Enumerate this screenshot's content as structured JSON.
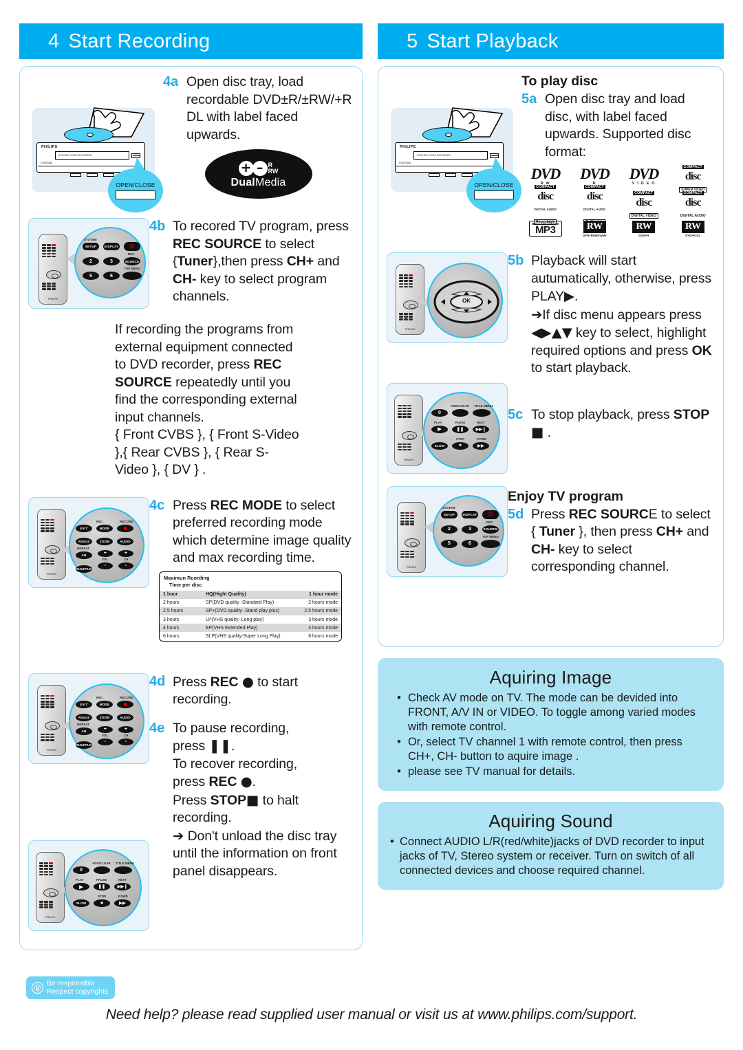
{
  "sections": {
    "recording": {
      "number": "4",
      "title": "Start Recording"
    },
    "playback": {
      "number": "5",
      "title": "Start Playback"
    }
  },
  "recording_steps": {
    "a": {
      "num": "4a",
      "text": "Open disc tray, load recordable DVD±R/±RW/+R DL with label faced upwards."
    },
    "b": {
      "num": "4b",
      "line1": "To recored TV program,",
      "press1": "press ",
      "bold1": "REC SOURCE",
      "after1": " to select {",
      "bold2": "Tuner",
      "after2": "},then press ",
      "bold3": "CH+",
      "and": " and ",
      "bold4": "CH-",
      "after3": " key to select program channels.",
      "para2_a": "If recording the programs from external equipment connected to DVD recorder, press ",
      "para2_bold": "REC SOURCE",
      "para2_b": " repeatedly until you find the corresponding external input channels.",
      "para3": "{ Front CVBS }, { Front S-Video },{ Rear CVBS }, { Rear S-Video }, { DV } ."
    },
    "c": {
      "num": "4c",
      "pre": "Press ",
      "bold": "REC MODE",
      "post": " to select preferred recording mode which determine image quality and max recording time."
    },
    "d": {
      "num": "4d",
      "pre": "Press ",
      "bold": "REC",
      "glyph": "●",
      "post": " to start recording."
    },
    "e": {
      "num": "4e",
      "l1": "To pause recording,",
      "l2_pre": "press ",
      "l2_glyph": "❚❚",
      "l2_post": ".",
      "l3": "To recover recording,",
      "l4_pre": "press ",
      "l4_bold": "REC",
      "l4_glyph": "●",
      "l4_post": ".",
      "l5_pre": "Press ",
      "l5_bold": "STOP",
      "l5_glyph": "■",
      "l5_post": " to halt recording.",
      "l6_arrow": "➔",
      "l6": " Don't unload the disc tray until the information on front panel disappears."
    }
  },
  "rec_table": {
    "title_line1": "Maximun Rcording",
    "title_line2": "Time per disc",
    "rows": [
      {
        "time": "1 hour",
        "mode": "HQ(Hight Quality)",
        "max": "1 hour mode"
      },
      {
        "time": "2 hours",
        "mode": "SP(DVD quality -Standard Play)",
        "max": "2 hours mode"
      },
      {
        "time": "2.5 hours",
        "mode": "SP+(DVD quality- Stand play plus)",
        "max": "2.5 hours mode"
      },
      {
        "time": "3 hours",
        "mode": "LP(VHS quality- Long play)",
        "max": "3 hours mode"
      },
      {
        "time": "4 hours",
        "mode": "EP(VHS Extended Play)",
        "max": "4 hours mode"
      },
      {
        "time": "6 hours",
        "mode": "SLP(VHS quality-Super Long Play)",
        "max": "6 hours mode"
      }
    ]
  },
  "playback_steps": {
    "heading_play": "To play disc",
    "a": {
      "num": "5a",
      "text": "Open disc tray and load disc,  with label faced upwards.",
      "supported": "Supported disc format:"
    },
    "b": {
      "num": "5b",
      "l1": "Playback will start autumatically,  otherwise, press  PLAY",
      "l1_glyph": "▶",
      "l1_end": ".",
      "arrow": "➔",
      "l2": "If disc menu appears press ",
      "l2_glyphs": "◀▶▲▼",
      "l3_pre": " key to select, highlight  required options and press ",
      "l3_bold": "OK",
      "l3_post": " to start playback."
    },
    "c": {
      "num": "5c",
      "pre": "To stop playback, press ",
      "bold": "STOP",
      "glyph": "■",
      "post": " ."
    },
    "heading_enjoy": "Enjoy  TV program",
    "d": {
      "num": "5d",
      "pre": "Press ",
      "bold1": "REC SOURC",
      "mid1": "E to select { ",
      "bold2": "Tuner",
      "mid2": " }, then press ",
      "bold3": "CH+",
      "mid3": " and ",
      "bold4": "CH-",
      "post": "  key to select corresponding channel."
    }
  },
  "aquiring_image": {
    "title": "Aquiring Image",
    "bullets": [
      "Check AV mode on TV.  The mode can be devided into FRONT, A/V IN or VIDEO. To toggle among varied modes with remote control.",
      "Or, select TV channel 1 with remote control, then press CH+, CH- button to aquire image .",
      "please see TV manual for details."
    ],
    "bullet_glyph": "•"
  },
  "aquiring_sound": {
    "title": "Aquiring Sound",
    "bullets": [
      "Connect AUDIO L/R(red/white)jacks of DVD recorder to input jacks of  TV, Stereo system or receiver. Turn on switch of all connected devices and choose required channel."
    ],
    "bullet_glyph": "•"
  },
  "footer": {
    "responsible_line1": "Be responsible",
    "responsible_line2": "Respect copyrights",
    "copy_glyph": "Ⓤ",
    "need_help": "Need help? please read supplied user manual or visit us at www.philips.com/support."
  },
  "device": {
    "brand": "PHILIPS",
    "front_text": "DVD/HDD  VIDEO  RECORDER",
    "sub_text": "DVDR3355",
    "open_close_label": "OPEN/CLOSE"
  },
  "dual_media": {
    "plus": "+",
    "minus": "–",
    "r": "R",
    "rw": "RW",
    "dual": "Dual",
    "media": "Media"
  },
  "disc_logos": [
    {
      "type": "dvd",
      "main": "DVD",
      "sub": "R W"
    },
    {
      "type": "dvd",
      "main": "DVD",
      "sub": "R"
    },
    {
      "type": "dvd",
      "main": "DVD",
      "sub": "V I D E O"
    },
    {
      "type": "cd",
      "cap": "COMPACT",
      "disc": "disc",
      "foot": "SUPER VIDEO"
    },
    {
      "type": "cd",
      "cap": "COMPACT",
      "disc": "disc",
      "mid": "DIGITAL AUDIO",
      "foot": "Recordable"
    },
    {
      "type": "cd",
      "cap": "COMPACT",
      "disc": "disc",
      "mid": "DIGITAL AUDIO",
      "foot": "ReWritable"
    },
    {
      "type": "cd",
      "cap": "COMPACT",
      "disc": "disc",
      "foot": "DIGITAL VIDEO"
    },
    {
      "type": "cd",
      "cap": "COMPACT",
      "disc": "disc",
      "foot": "DIGITAL AUDIO"
    },
    {
      "type": "mp3",
      "cap": "MP3-CD PLAYBACK",
      "main": "MP3"
    },
    {
      "type": "rw",
      "main": "RW",
      "label": "DVD+ReWritable"
    },
    {
      "type": "rw",
      "main": "RW",
      "label": "DVD+R"
    },
    {
      "type": "rw",
      "main": "RW",
      "label": "DVD+R DL"
    }
  ],
  "remote_keys": {
    "numeric": {
      "labels": [
        "SYSTEM",
        "REC",
        "TOP MENU"
      ],
      "keys": [
        "SETUP",
        "DISPLAY",
        "2",
        "3",
        "SOURCE",
        "5",
        "6"
      ]
    },
    "recmode": {
      "labels": [
        "REC",
        "RECORD",
        "REPEAT"
      ],
      "keys": [
        "EXIT",
        "MODE",
        "ANGLE",
        "ZOOM",
        "AUDIO",
        "AB",
        "SHUFFLE",
        "VOL",
        "CH",
        "+",
        "-"
      ]
    },
    "transport": {
      "labels": [
        "PLAY",
        "PAUSE",
        "NEXT",
        "STOP",
        "F.FWD",
        "ADD/CLEAR",
        "TITLE MENU"
      ],
      "keys": [
        "0",
        "SLOW"
      ]
    },
    "nav": {
      "ok": "OK",
      "up": "▲",
      "down": "▼",
      "left": "◀",
      "right": "▶"
    }
  },
  "colors": {
    "brand_blue": "#00AEEF",
    "step_blue": "#29ABE2",
    "panel_border": "#9BD9F2",
    "info_bg": "#ADE3F2",
    "callout_cyan": "#4FD0F5"
  }
}
